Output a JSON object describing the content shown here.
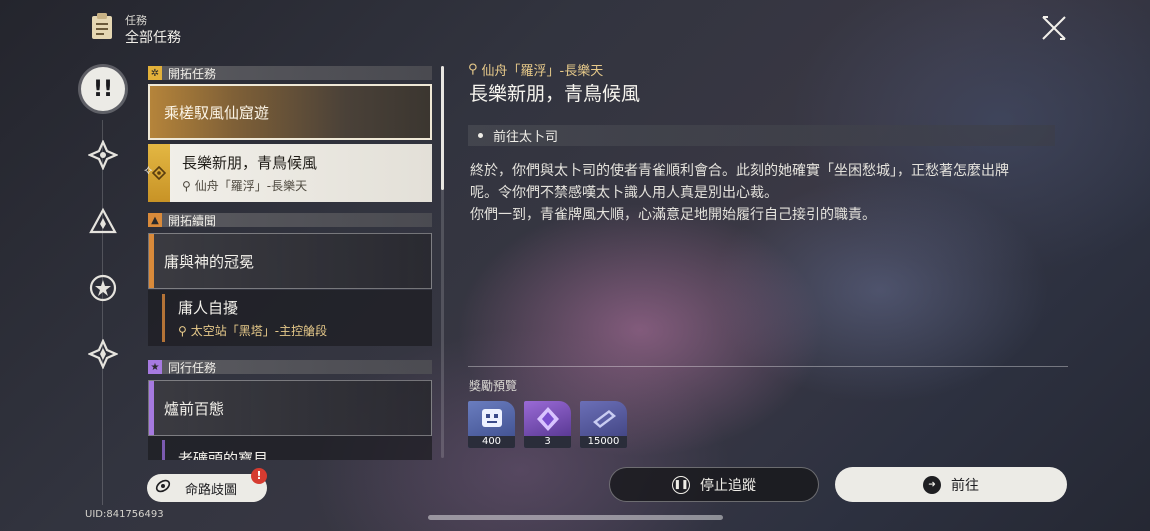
{
  "header": {
    "category": "任務",
    "title": "全部任務"
  },
  "colors": {
    "gold": "#e6c98a",
    "trailblaze": "#e2b13a",
    "companion": "#a67ae0",
    "adventure": "#d98a3a"
  },
  "rail": {
    "items": [
      "all-missions",
      "trailblaze",
      "companion",
      "adventure",
      "daily"
    ]
  },
  "list": {
    "categories": [
      {
        "label": "開拓任務"
      },
      {
        "label": "開拓續聞"
      },
      {
        "label": "同行任務"
      }
    ],
    "items": [
      {
        "label": "乘槎馭風仙窟遊"
      },
      {
        "label": "長樂新朋，青鳥候風",
        "location": "仙舟「羅浮」-長樂天"
      },
      {
        "label": "庸與神的冠冕"
      },
      {
        "label": "庸人自擾",
        "location": "太空站「黑塔」-主控艙段"
      },
      {
        "label": "爐前百態"
      },
      {
        "label": "老礦頭的寶貝"
      }
    ]
  },
  "detail": {
    "location": "仙舟「羅浮」-長樂天",
    "title": "長樂新朋，青鳥候風",
    "objective": "前往太卜司",
    "description_lines": [
      "終於，你們與太卜司的使者青雀順利會合。此刻的她確實「坐困愁城」，正愁著怎麼出牌",
      "呢。令你們不禁感嘆太卜識人用人真是別出心裁。",
      "你們一到，青雀牌風大順，心滿意足地開始履行自己接引的職責。"
    ],
    "rewards_title": "獎勵預覽",
    "rewards": [
      {
        "icon": "trailblaze-exp-icon",
        "count": "400"
      },
      {
        "icon": "purple-material-icon",
        "count": "3"
      },
      {
        "icon": "credit-icon",
        "count": "15000"
      }
    ]
  },
  "buttons": {
    "stop_tracking": "停止追蹤",
    "go": "前往",
    "path_tree": "命路歧圖",
    "path_alert": "!"
  },
  "footer": {
    "uid": "UID:841756493"
  }
}
